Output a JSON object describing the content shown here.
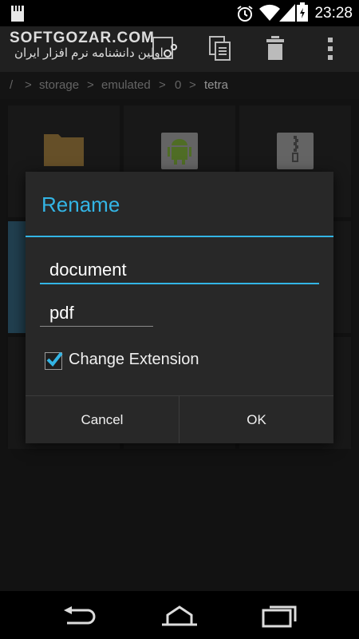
{
  "status_bar": {
    "time": "23:28"
  },
  "watermark": {
    "brand": "SOFTGOZAR.COM",
    "subtitle": "اولین دانشنامه نرم افزار ایران"
  },
  "breadcrumb": [
    "/",
    ">",
    "storage",
    ">",
    "emulated",
    ">",
    "0",
    ">",
    "tetra"
  ],
  "dialog": {
    "title": "Rename",
    "name_value": "document",
    "extension_value": "pdf",
    "checkbox_label": "Change Extension",
    "checkbox_checked": true,
    "cancel_label": "Cancel",
    "ok_label": "OK"
  },
  "colors": {
    "accent": "#33b5e5",
    "folder": "#9b7a3e",
    "android_green": "#7aa83a"
  },
  "icons": [
    "battery-icon",
    "signal-icon",
    "wifi-icon",
    "alarm-icon",
    "sd-card-icon",
    "cut-icon",
    "copy-icon",
    "delete-icon",
    "overflow-menu-icon",
    "folder-icon",
    "apk-file-icon",
    "zip-file-icon",
    "back-icon",
    "home-icon",
    "recents-icon"
  ]
}
